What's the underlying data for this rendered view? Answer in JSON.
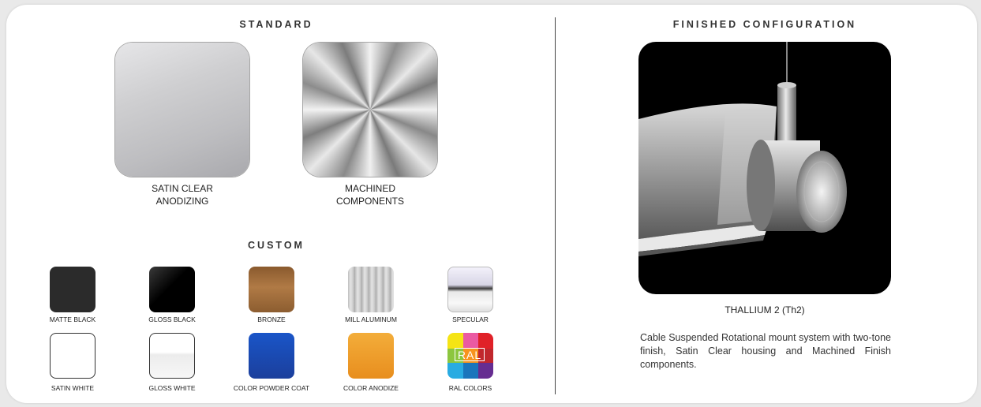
{
  "standard": {
    "heading": "STANDARD",
    "items": [
      {
        "line1": "SATIN CLEAR",
        "line2": "ANODIZING"
      },
      {
        "line1": "MACHINED",
        "line2": "COMPONENTS"
      }
    ]
  },
  "custom": {
    "heading": "CUSTOM",
    "swatches": [
      {
        "label": "MATTE BLACK",
        "color": "#2a2a2a"
      },
      {
        "label": "GLOSS BLACK",
        "color": "#000000"
      },
      {
        "label": "BRONZE",
        "color": "#9a6a3c"
      },
      {
        "label": "MILL ALUMINUM",
        "color": "#c8c8c8"
      },
      {
        "label": "SPECULAR",
        "color": "#dcdcdc"
      },
      {
        "label": "SATIN WHITE",
        "color": "#ffffff"
      },
      {
        "label": "GLOSS WHITE",
        "color": "#ffffff"
      },
      {
        "label": "COLOR POWDER COAT",
        "color": "#1c46a8"
      },
      {
        "label": "COLOR ANODIZE",
        "color": "#f0a02c"
      },
      {
        "label": "RAL COLORS",
        "badge": "RAL"
      }
    ]
  },
  "finished": {
    "heading": "FINISHED CONFIGURATION",
    "product_caption": "THALLIUM 2 (Th2)",
    "description": "Cable Suspended Rotational mount system with two-tone finish, Satin Clear housing and Machined Finish components."
  }
}
